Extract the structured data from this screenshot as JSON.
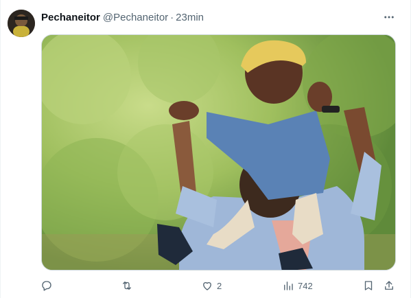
{
  "tweet": {
    "author_name": "Pechaneitor",
    "author_handle": "@Pechaneitor",
    "separator": "·",
    "timestamp": "23min",
    "avatar_icon": "user-avatar",
    "media_description_icon": "photo",
    "actions": {
      "reply": {
        "icon": "reply-icon",
        "count": ""
      },
      "retweet": {
        "icon": "retweet-icon",
        "count": ""
      },
      "like": {
        "icon": "heart-icon",
        "count": "2"
      },
      "views": {
        "icon": "views-chart-icon",
        "count": "742"
      },
      "bookmark": {
        "icon": "bookmark-icon"
      },
      "share": {
        "icon": "share-icon"
      }
    }
  },
  "colors": {
    "text_primary": "#0f1419",
    "text_secondary": "#536471",
    "border": "#cfd9de"
  }
}
